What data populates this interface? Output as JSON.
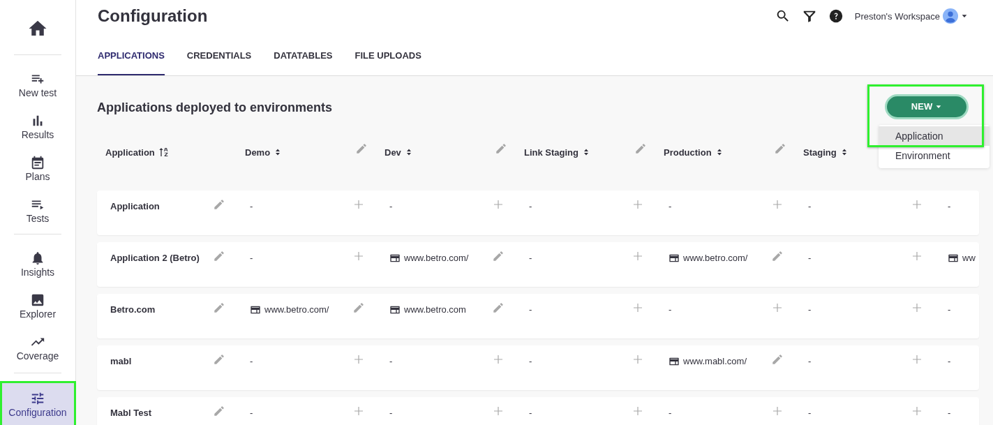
{
  "sidebar": {
    "items": [
      {
        "kind": "home",
        "selected": false,
        "highlighted": false
      },
      {
        "kind": "divider"
      },
      {
        "kind": "newtest",
        "label": "New test",
        "selected": false,
        "highlighted": false
      },
      {
        "kind": "results",
        "label": "Results",
        "selected": false,
        "highlighted": false
      },
      {
        "kind": "plans",
        "label": "Plans",
        "selected": false,
        "highlighted": false
      },
      {
        "kind": "tests",
        "label": "Tests",
        "selected": false,
        "highlighted": false
      },
      {
        "kind": "divider"
      },
      {
        "kind": "insights",
        "label": "Insights",
        "selected": false,
        "highlighted": false
      },
      {
        "kind": "explorer",
        "label": "Explorer",
        "selected": false,
        "highlighted": false
      },
      {
        "kind": "coverage",
        "label": "Coverage",
        "selected": false,
        "highlighted": false
      },
      {
        "kind": "divider"
      },
      {
        "kind": "configuration",
        "label": "Configuration",
        "selected": true,
        "highlighted": true
      }
    ]
  },
  "header": {
    "title": "Configuration",
    "workspace": "Preston's Workspace"
  },
  "tabs": [
    {
      "label": "APPLICATIONS",
      "selected": true
    },
    {
      "label": "CREDENTIALS",
      "selected": false
    },
    {
      "label": "DATATABLES",
      "selected": false
    },
    {
      "label": "FILE UPLOADS",
      "selected": false
    }
  ],
  "section_title": "Applications deployed to environments",
  "new_button": {
    "label": "NEW",
    "highlighted": true
  },
  "new_menu": [
    {
      "label": "Application",
      "selected": true
    },
    {
      "label": "Environment",
      "selected": false
    }
  ],
  "table": {
    "first_column": "Application",
    "columns": [
      {
        "label": "Demo",
        "edit_icon": true
      },
      {
        "label": "Dev",
        "edit_icon": true
      },
      {
        "label": "Link Staging",
        "edit_icon": true
      },
      {
        "label": "Production",
        "edit_icon": true
      },
      {
        "label": "Staging",
        "edit_icon": false
      }
    ],
    "rows": [
      {
        "name": "Application",
        "cells": [
          {
            "kind": "empty",
            "value": "-"
          },
          {
            "kind": "empty",
            "value": "-"
          },
          {
            "kind": "empty",
            "value": "-"
          },
          {
            "kind": "empty",
            "value": "-"
          },
          {
            "kind": "empty",
            "value": "-"
          },
          {
            "kind": "empty",
            "value": "-"
          }
        ]
      },
      {
        "name": "Application 2 (Betro)",
        "cells": [
          {
            "kind": "empty",
            "value": "-"
          },
          {
            "kind": "url",
            "value": "www.betro.com/"
          },
          {
            "kind": "empty",
            "value": "-"
          },
          {
            "kind": "url",
            "value": "www.betro.com/"
          },
          {
            "kind": "empty",
            "value": "-"
          },
          {
            "kind": "url",
            "value": "ww"
          }
        ]
      },
      {
        "name": "Betro.com",
        "cells": [
          {
            "kind": "url",
            "value": "www.betro.com/"
          },
          {
            "kind": "url",
            "value": "www.betro.com"
          },
          {
            "kind": "empty",
            "value": "-"
          },
          {
            "kind": "empty",
            "value": "-"
          },
          {
            "kind": "empty",
            "value": "-"
          },
          {
            "kind": "empty",
            "value": "-"
          }
        ]
      },
      {
        "name": "mabl",
        "cells": [
          {
            "kind": "empty",
            "value": "-"
          },
          {
            "kind": "empty",
            "value": "-"
          },
          {
            "kind": "empty",
            "value": "-"
          },
          {
            "kind": "url",
            "value": "www.mabl.com/"
          },
          {
            "kind": "empty",
            "value": "-"
          },
          {
            "kind": "empty",
            "value": "-"
          }
        ]
      },
      {
        "name": "Mabl Test",
        "cells": [
          {
            "kind": "empty",
            "value": "-"
          },
          {
            "kind": "empty",
            "value": "-"
          },
          {
            "kind": "empty",
            "value": "-"
          },
          {
            "kind": "empty",
            "value": "-"
          },
          {
            "kind": "empty",
            "value": "-"
          },
          {
            "kind": "empty",
            "value": "-"
          }
        ]
      }
    ]
  }
}
